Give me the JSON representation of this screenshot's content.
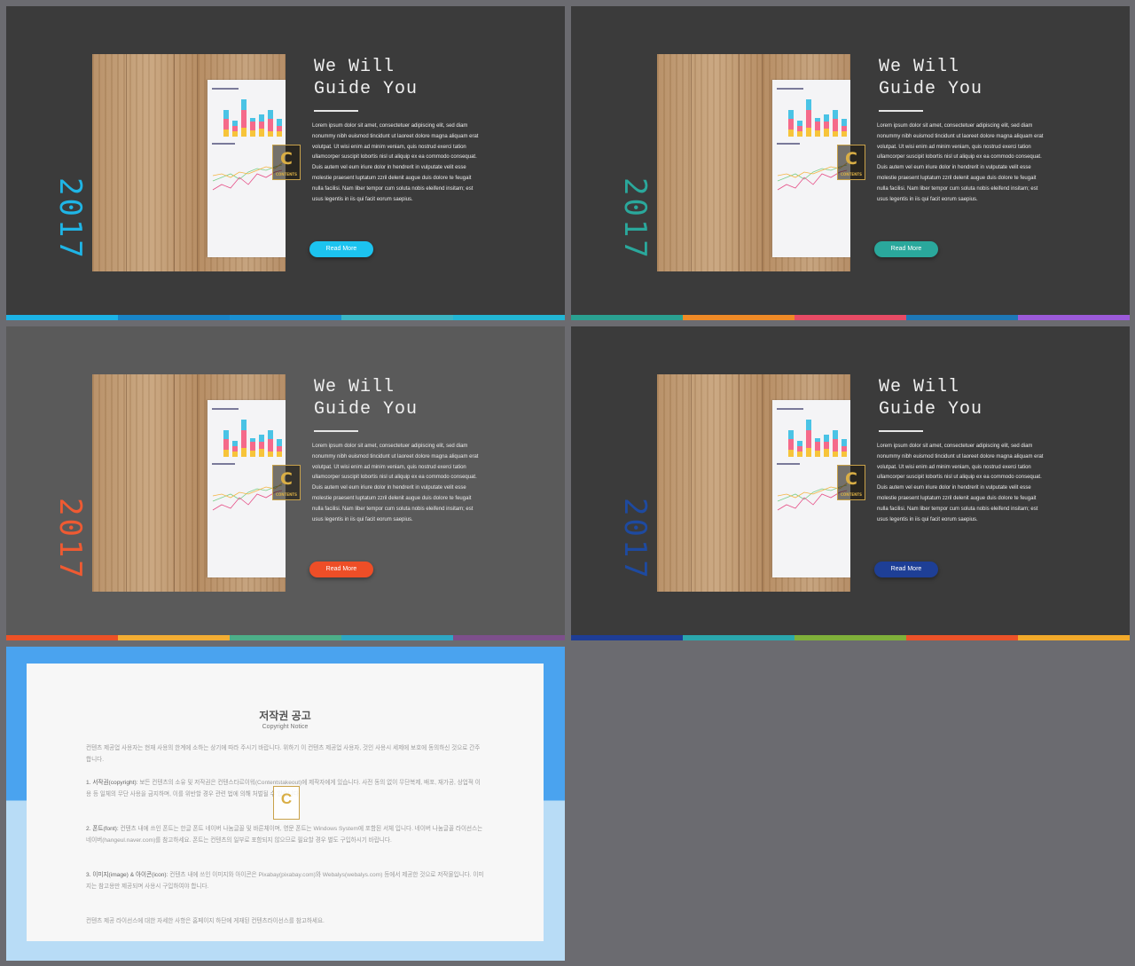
{
  "slides": [
    {
      "title": "We Will\nGuide You",
      "year": "2017",
      "button": "Read More",
      "year_color": "#1fb5e6",
      "button_color": "#1cc3ef",
      "stripe": [
        "#1cb3e6",
        "#1985c8",
        "#1a8fd0",
        "#3bb6c4",
        "#22b6d4"
      ]
    },
    {
      "title": "We Will\nGuide You",
      "year": "2017",
      "button": "Read More",
      "year_color": "#2aa89c",
      "button_color": "#2aa89c",
      "stripe": [
        "#2aa191",
        "#ef8a26",
        "#e74b65",
        "#1e78b7",
        "#9b5ad9"
      ]
    },
    {
      "title": "We Will\nGuide You",
      "year": "2017",
      "button": "Read More",
      "year_color": "#ef5a32",
      "button_color": "#ee4e27",
      "stripe": [
        "#ec5126",
        "#f3ad33",
        "#4caf88",
        "#2ea6c4",
        "#7d4f8b"
      ]
    },
    {
      "title": "We Will\nGuide You",
      "year": "2017",
      "button": "Read More",
      "year_color": "#1e4aa0",
      "button_color": "#1e3f96",
      "stripe": [
        "#1e3d96",
        "#2aa7ad",
        "#7fb03a",
        "#ec5229",
        "#f1a92a"
      ]
    }
  ],
  "body_text": "Lorem  ipsum dolor sit amet, consectetuer  adipiscing elit, sed diam nonummy  nibh euismod tincidunt ut laoreet dolore magna  aliquam erat volutpat.  Ut wisi enim ad minim veniam,  quis nostrud exerci tation ullamcorper suscipit lobortis nisl ut aliquip ex ea commodo consequat.  Duis autem vel eum  iriure dolor in hendrerit in vulputate velit esse molestie praesent luptatum zzril delenit augue duis dolore te feugait nulla facilisi. Nam liber tempor  cum  soluta nobis eleifend insitam; est usus legentis in iis qui facit eorum  saepius.",
  "logo_letter": "C",
  "logo_text": "CONTENTS",
  "copyright": {
    "title": "저작권 공고",
    "subtitle": "Copyright Notice",
    "p0": "컨텐츠 제공업 사용자는 현재 사용의 한계에 소하는 상기에 따라 주시기 바랍니다. 위하기 이 컨텐츠 제공업 사용자, 것인 사용시 세제에 보호에 동의하신 것으로 간주합니다.",
    "p1_head": "1. 서작권(copyright):",
    "p1": " 보든 컨텐츠의 소유 및 저작권은 컨텐스타르이워(Contentstakeout)에 제작자에게 있습니다. 사전 동의 없이 무단복제, 배포, 재가공, 상업적 이용 등 일체의 무단 사용을 금지하며, 이를 위반할 경우 관련 법에 의해 처벌될 수 있습니다.",
    "p2_head": "2. 폰트(font):",
    "p2": " 컨텐츠 내에 쓰인 폰트는 한글 폰트 네이버 나눔글꼴 및 바른체이며, 영문 폰트는 Windows System에 포함된 서체 입니다. 네이버 나눔글꼴 라이선스는 네이버(hangeul.naver.com)를 참고하세요. 폰트는 컨텐츠의 일부로 포함되지 않으므로 필요할 경우 별도 구입하시기 바랍니다.",
    "p3_head": "3. 이미지(image) & 아이콘(icon):",
    "p3": " 컨텐츠 내에 쓰인 이미지와 아이콘은 Pixabay(pixabay.com)와 Webalys(webalys.com) 등에서 제공한 것으로 저작물입니다. 이미지는 참고용만 제공되며 사용시 구입하여야 합니다.",
    "p4": "컨텐츠 제공 라이선스에 대한 자세한 사항은 홈페이지 하단에 게재된 컨텐츠라이선스를 참고하세요."
  }
}
